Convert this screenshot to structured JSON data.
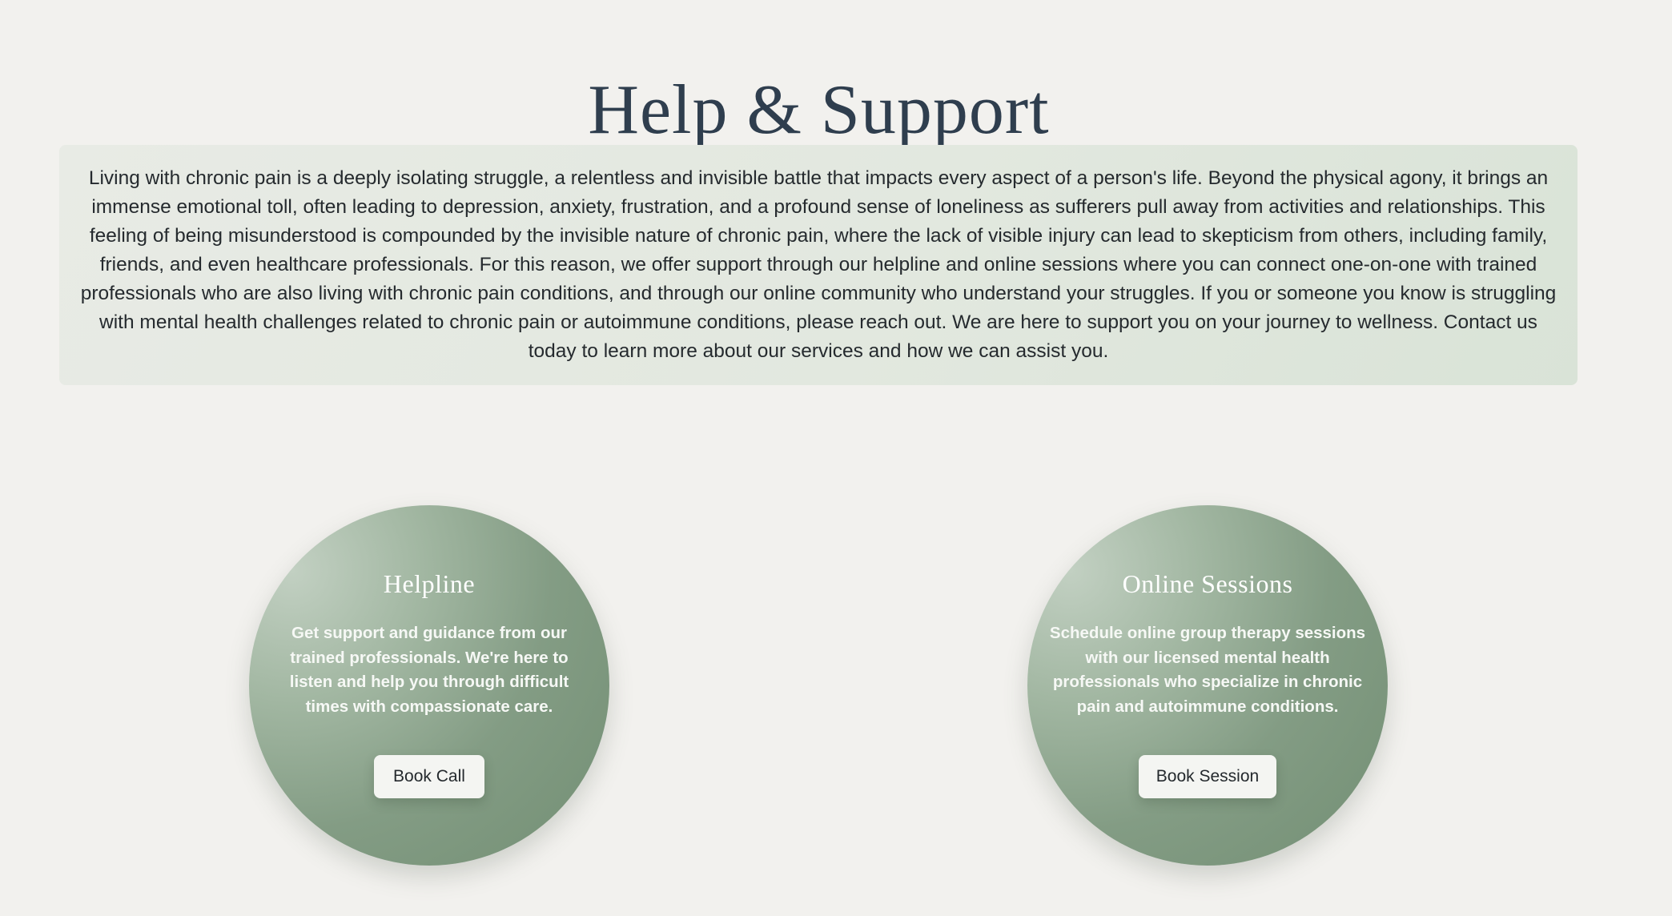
{
  "header": {
    "title": "Help & Support"
  },
  "intro": {
    "text": "Living with chronic pain is a deeply isolating struggle, a relentless and invisible battle that impacts every aspect of a person's life. Beyond the physical agony, it brings an immense emotional toll, often leading to depression, anxiety, frustration, and a profound sense of loneliness as sufferers pull away from activities and relationships. This feeling of being misunderstood is compounded by the invisible nature of chronic pain, where the lack of visible injury can lead to skepticism from others, including family, friends, and even healthcare professionals. For this reason, we offer support through our helpline and online sessions where you can connect one-on-one with trained professionals who are also living with chronic pain conditions, and through our online community who understand your struggles. If you or someone you know is struggling with mental health challenges related to chronic pain or autoimmune conditions, please reach out. We are here to support you on your journey to wellness. Contact us today to learn more about our services and how we can assist you."
  },
  "cards": [
    {
      "title": "Helpline",
      "description": "Get support and guidance from our trained professionals. We're here to listen and help you through difficult times with compassionate care.",
      "button_label": "Book Call"
    },
    {
      "title": "Online Sessions",
      "description": "Schedule online group therapy sessions with our licensed mental health professionals who specialize in chronic pain and autoimmune conditions.",
      "button_label": "Book Session"
    }
  ],
  "colors": {
    "background": "#f2f1ee",
    "title": "#2f3e4e",
    "intro_box": "#e2e8df",
    "circle_light": "#c2d0c2",
    "circle_dark": "#738f74",
    "button": "#f4f5f2"
  }
}
